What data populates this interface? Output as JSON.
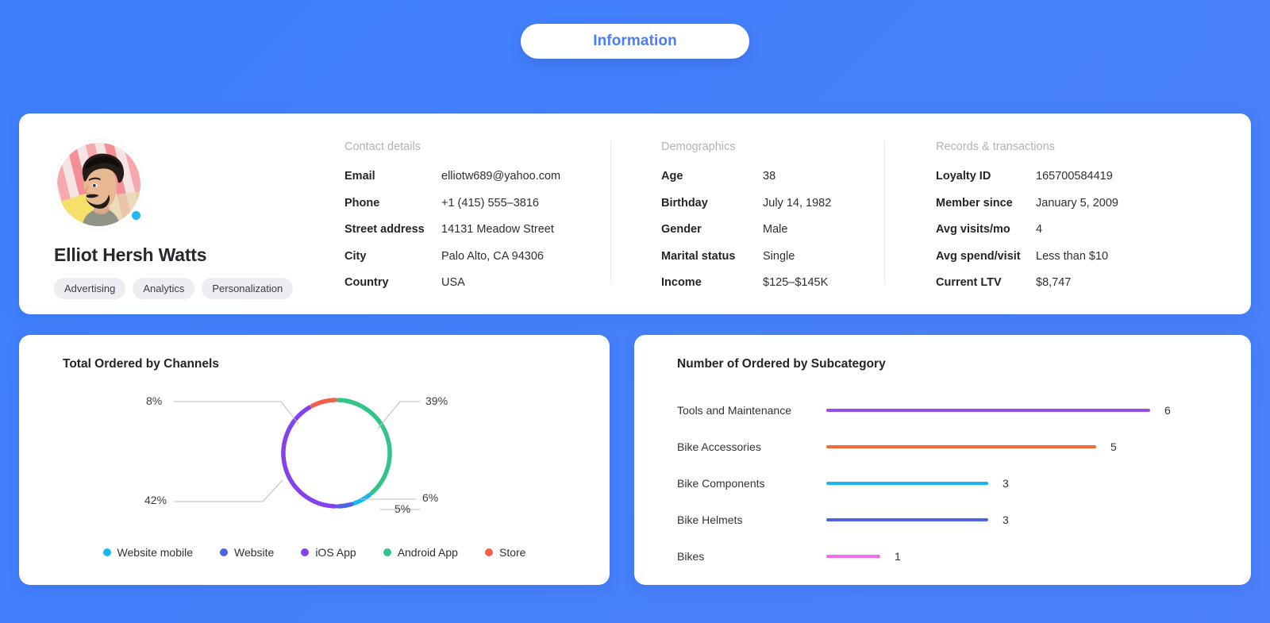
{
  "tab": {
    "label": "Information"
  },
  "profile": {
    "name": "Elliot Hersh Watts",
    "avatar_alt": "user-portrait",
    "status": "online",
    "tags": [
      "Advertising",
      "Analytics",
      "Personalization"
    ]
  },
  "details": [
    {
      "title": "Contact details",
      "rows": [
        {
          "key": "Email",
          "value": "elliotw689@yahoo.com"
        },
        {
          "key": "Phone",
          "value": "+1 (415) 555–3816"
        },
        {
          "key": "Street address",
          "value": "14131 Meadow Street"
        },
        {
          "key": "City",
          "value": "Palo Alto, CA 94306"
        },
        {
          "key": "Country",
          "value": "USA"
        }
      ]
    },
    {
      "title": "Demographics",
      "rows": [
        {
          "key": "Age",
          "value": "38"
        },
        {
          "key": "Birthday",
          "value": "July 14, 1982"
        },
        {
          "key": "Gender",
          "value": "Male"
        },
        {
          "key": "Marital status",
          "value": "Single"
        },
        {
          "key": "Income",
          "value": "$125–$145K"
        }
      ]
    },
    {
      "title": "Records & transactions",
      "rows": [
        {
          "key": "Loyalty ID",
          "value": "165700584419"
        },
        {
          "key": "Member since",
          "value": "January 5, 2009"
        },
        {
          "key": "Avg visits/mo",
          "value": "4"
        },
        {
          "key": "Avg spend/visit",
          "value": "Less than $10"
        },
        {
          "key": "Current LTV",
          "value": "$8,747"
        }
      ]
    }
  ],
  "chart_data": [
    {
      "type": "pie",
      "title": "Total Ordered by Channels",
      "variant": "donut",
      "legend_position": "bottom",
      "categories": [
        "Website mobile",
        "Website",
        "iOS App",
        "Android App",
        "Store"
      ],
      "values": [
        6,
        5,
        42,
        39,
        8
      ],
      "labels": [
        "6%",
        "5%",
        "42%",
        "39%",
        "8%"
      ],
      "colors": [
        "#15b9f0",
        "#4f62e8",
        "#8442ef",
        "#33c587",
        "#f2604a"
      ],
      "segment_order_clockwise_from_top": [
        {
          "name": "Android App",
          "value": 39,
          "label": "39%",
          "color": "#33c587"
        },
        {
          "name": "Website mobile",
          "value": 6,
          "label": "6%",
          "color": "#15b9f0"
        },
        {
          "name": "Website",
          "value": 5,
          "label": "5%",
          "color": "#4f62e8"
        },
        {
          "name": "iOS App",
          "value": 42,
          "label": "42%",
          "color": "#8442ef"
        },
        {
          "name": "Store",
          "value": 8,
          "label": "8%",
          "color": "#f2604a"
        }
      ]
    },
    {
      "type": "bar",
      "orientation": "horizontal",
      "title": "Number of Ordered by Subcategory",
      "xlabel": "",
      "ylabel": "",
      "xlim": [
        0,
        6
      ],
      "grid": false,
      "categories": [
        "Tools and Maintenance",
        "Bike Accessories",
        "Bike Components",
        "Bike Helmets",
        "Bikes"
      ],
      "values": [
        6,
        5,
        3,
        3,
        1
      ],
      "value_labels": [
        "6",
        "5",
        "3",
        "3",
        "1"
      ],
      "colors": [
        "#9a4ded",
        "#ef6b3c",
        "#18b6f0",
        "#4e62e8",
        "#f06cf0"
      ]
    }
  ]
}
